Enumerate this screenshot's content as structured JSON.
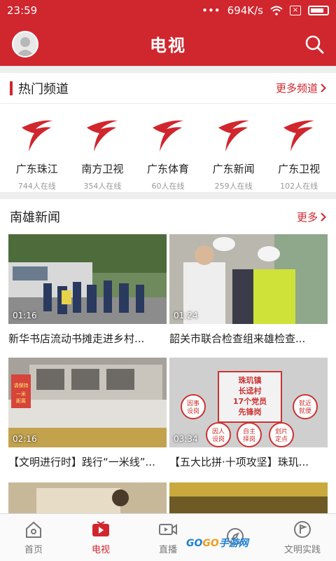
{
  "status": {
    "time": "23:59",
    "speed": "694K/s"
  },
  "app": {
    "title": "电视"
  },
  "hot": {
    "title": "热门频道",
    "more": "更多频道",
    "channels": [
      {
        "name": "广东珠江",
        "viewers": "744人在线"
      },
      {
        "name": "南方卫视",
        "viewers": "354人在线"
      },
      {
        "name": "广东体育",
        "viewers": "60人在线"
      },
      {
        "name": "广东新闻",
        "viewers": "259人在线"
      },
      {
        "name": "广东卫视",
        "viewers": "102人在线"
      }
    ]
  },
  "news": {
    "title": "南雄新闻",
    "more": "更多",
    "videos": [
      {
        "duration": "01:16",
        "caption": "新华书店流动书摊走进乡村..."
      },
      {
        "duration": "01:24",
        "caption": "韶关市联合检查组来雄检查..."
      },
      {
        "duration": "02:16",
        "caption": "【文明进行时】践行“一米线”..."
      },
      {
        "duration": "03:34",
        "caption": "【五大比拼·十项攻坚】珠玑..."
      }
    ],
    "sign_text": {
      "headline_1": "珠玑镇",
      "headline_2": "长迳村",
      "headline_3": "17个党员",
      "headline_4": "先锋岗",
      "b1": "因事设岗",
      "b2": "就近就便",
      "b3": "因人设岗",
      "b4": "自主择岗",
      "b5": "划片定点"
    },
    "shop_sign": "请保持一米距离"
  },
  "tabs": [
    {
      "label": "首页",
      "icon": "home-icon"
    },
    {
      "label": "电视",
      "icon": "tv-play-icon"
    },
    {
      "label": "直播",
      "icon": "video-camera-icon"
    },
    {
      "label": "",
      "icon": "compass-icon"
    },
    {
      "label": "文明实践",
      "icon": "flag-icon"
    }
  ],
  "watermark": {
    "part1": "GO",
    "part2": "GO",
    "part3": "手游网"
  },
  "colors": {
    "brand": "#d0262e",
    "tab_inactive": "#777777"
  }
}
